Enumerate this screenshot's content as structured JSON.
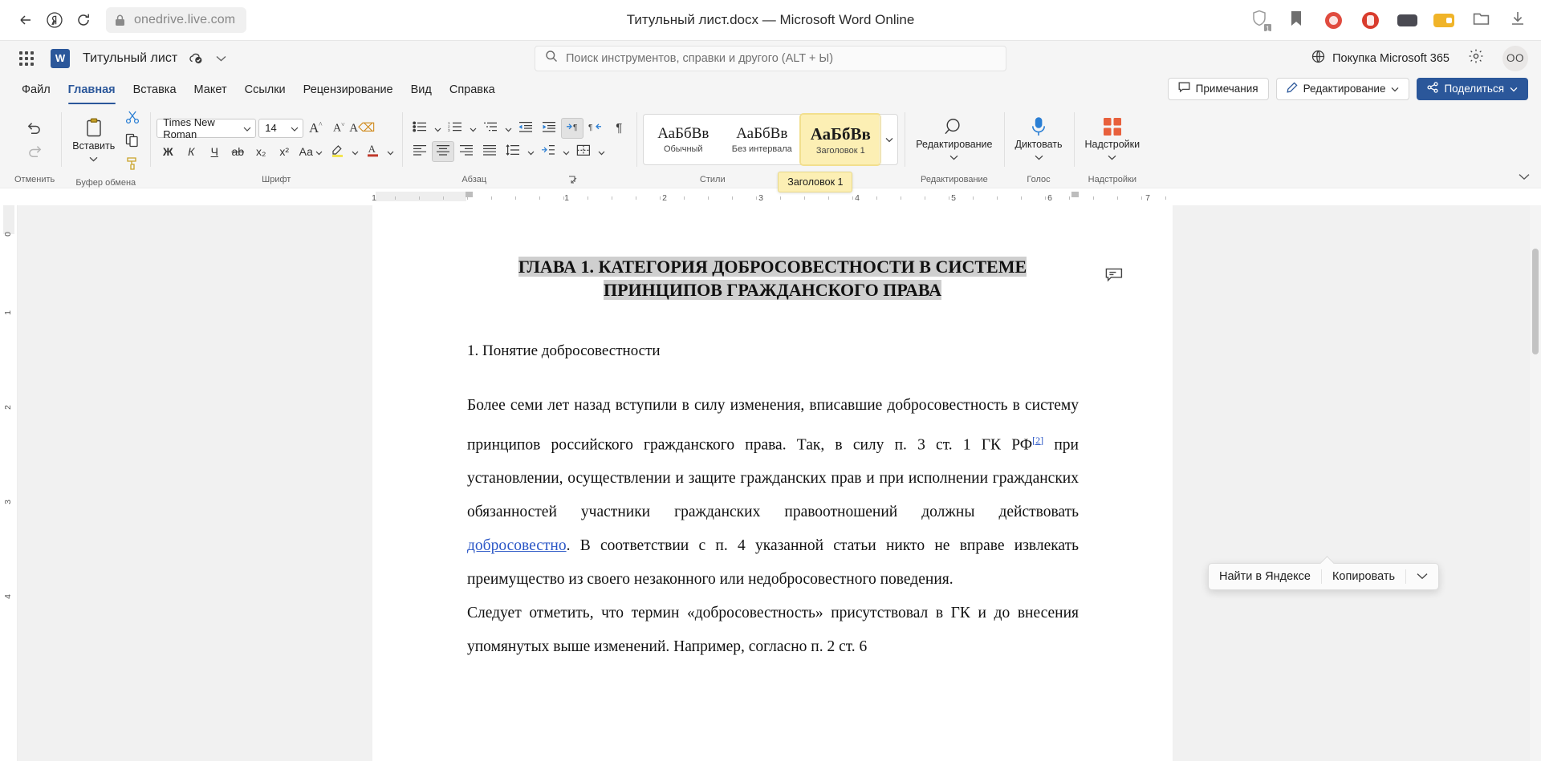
{
  "browser": {
    "back_icon": "arrow-left-icon",
    "yandex_icon": "yandex-logo-icon",
    "reload_icon": "reload-icon",
    "lock_icon": "lock-icon",
    "url": "onedrive.live.com",
    "page_title": "Титульный лист.docx — Microsoft Word Online",
    "right_icons": [
      {
        "name": "shield-icon",
        "badge": "1"
      },
      {
        "name": "bookmark-icon",
        "badge": ""
      },
      {
        "name": "extension-red-icon",
        "badge": ""
      },
      {
        "name": "extension-red2-icon",
        "badge": ""
      },
      {
        "name": "extension-dark-icon",
        "badge": ""
      },
      {
        "name": "extension-yellow-icon",
        "badge": ""
      },
      {
        "name": "collections-icon",
        "badge": ""
      },
      {
        "name": "downloads-icon",
        "badge": ""
      }
    ]
  },
  "app_header": {
    "waffle_icon": "app-launcher-icon",
    "word_logo": "W",
    "doc_name": "Титульный лист",
    "saved_icon": "saved-cloud-icon",
    "chevron_icon": "chevron-down-icon",
    "search": {
      "icon": "search-icon",
      "placeholder": "Поиск инструментов, справки и другого (ALT + Ы)",
      "value": ""
    },
    "buy_365": "Покупка Microsoft 365",
    "globe_icon": "globe-icon",
    "settings_icon": "gear-icon",
    "avatar_initials": "ОО"
  },
  "tabs": [
    {
      "label": "Файл",
      "active": false
    },
    {
      "label": "Главная",
      "active": true
    },
    {
      "label": "Вставка",
      "active": false
    },
    {
      "label": "Макет",
      "active": false
    },
    {
      "label": "Ссылки",
      "active": false
    },
    {
      "label": "Рецензирование",
      "active": false
    },
    {
      "label": "Вид",
      "active": false
    },
    {
      "label": "Справка",
      "active": false
    }
  ],
  "tabs_right": {
    "comments_label": "Примечания",
    "comments_icon": "comment-icon",
    "editing_label": "Редактирование",
    "editing_icon": "pencil-icon",
    "editing_chevron": "chevron-down-icon",
    "share_label": "Поделиться",
    "share_icon": "share-icon",
    "share_chevron": "chevron-down-icon"
  },
  "ribbon": {
    "groups": [
      {
        "label": "Отменить",
        "name": "undo-group"
      },
      {
        "label": "Буфер обмена",
        "name": "clipboard-group"
      },
      {
        "label": "Шрифт",
        "name": "font-group"
      },
      {
        "label": "Абзац",
        "name": "paragraph-group"
      },
      {
        "label": "Стили",
        "name": "styles-group"
      },
      {
        "label": "Редактирование",
        "name": "editing-group"
      },
      {
        "label": "Голос",
        "name": "voice-group"
      },
      {
        "label": "Надстройки",
        "name": "addins-group"
      }
    ],
    "undo": {
      "undo_icon": "undo-icon",
      "redo_icon": "redo-icon"
    },
    "clipboard": {
      "paste_label": "Вставить",
      "paste_icon": "paste-icon",
      "paste_chevron": "chevron-down-icon",
      "cut_icon": "scissors-icon",
      "copy_icon": "copy-icon",
      "format_painter_icon": "format-painter-icon"
    },
    "font": {
      "family": "Times New Roman",
      "size": "14",
      "grow_icon": "increase-font-size-icon",
      "shrink_icon": "decrease-font-size-icon",
      "clear_format_icon": "clear-formatting-icon",
      "bold": "Ж",
      "italic": "К",
      "underline": "Ч",
      "strike": "аb",
      "subscript": "x₂",
      "superscript": "x²",
      "case_label": "Аа",
      "highlight_icon": "highlight-color-icon",
      "font_color_icon": "font-color-icon"
    },
    "paragraph": {
      "bullets_icon": "bulleted-list-icon",
      "numbering_icon": "numbered-list-icon",
      "multilevel_icon": "multilevel-list-icon",
      "decrease_indent_icon": "decrease-indent-icon",
      "increase_indent_icon": "increase-indent-icon",
      "ltr_icon": "left-to-right-icon",
      "rtl_icon": "right-to-left-icon",
      "marks_icon": "formatting-marks-icon",
      "align_left_icon": "align-left-icon",
      "align_center_icon": "align-center-icon",
      "align_right_icon": "align-right-icon",
      "justify_icon": "justify-icon",
      "line_spacing_icon": "line-spacing-icon",
      "shading_icon": "shading-icon",
      "borders_icon": "borders-icon",
      "dialog_launcher_icon": "dialog-launcher-icon"
    },
    "styles": {
      "items": [
        {
          "sample": "АаБбВв",
          "name": "Обычный",
          "selected": false
        },
        {
          "sample": "АаБбВв",
          "name": "Без интервала",
          "selected": false
        },
        {
          "sample": "АаБбВв",
          "name": "Заголовок 1",
          "selected": true
        }
      ],
      "more_icon": "chevron-down-icon",
      "tooltip": "Заголовок 1",
      "dialog_launcher_icon": "dialog-launcher-icon"
    },
    "editing": {
      "label": "Редактирование",
      "icon": "magnifier-icon",
      "chevron": "chevron-down-icon"
    },
    "voice": {
      "label": "Диктовать",
      "icon": "microphone-icon",
      "chevron": "chevron-down-icon"
    },
    "addins": {
      "label": "Надстройки",
      "icon": "addins-grid-icon",
      "chevron": "chevron-down-icon"
    },
    "collapse_icon": "chevron-down-icon"
  },
  "ruler": {
    "h_labels": [
      "1",
      "1",
      "2",
      "3",
      "4",
      "5",
      "6",
      "7"
    ],
    "v_labels": [
      "1",
      "2",
      "3",
      "4"
    ]
  },
  "document": {
    "heading_line1": "ГЛАВА 1. КАТЕГОРИЯ ДОБРОСОВЕСТНОСТИ В СИСТЕМЕ",
    "heading_line2": "ПРИНЦИПОВ ГРАЖДАНСКОГО ПРАВА",
    "subheading": "1. Понятие добросовестности",
    "para1_a": "Более семи лет назад вступили в силу изменения, вписавшие добросовестность в систему принципов российского гражданского права. Так, в силу п. 3 ст. 1 ГК РФ",
    "footnote_ref": "[2]",
    "para1_b": " при установлении, осуществлении и защите гражданских прав и при исполнении гражданских обязанностей участники гражданских правоотношений должны действовать ",
    "link_text": "добросовестно",
    "para1_c": ". В соответствии с п. 4 указанной статьи никто не вправе извлекать преимущество из своего незаконного или недобросовестного поведения.",
    "para2": "Следует отметить, что термин «добросовестность» присутствовал в ГК и до внесения упомянутых выше изменений. Например, согласно п. 2 ст. 6",
    "comment_icon": "comment-bubble-icon"
  },
  "context_menu": {
    "items": [
      {
        "label": "Найти в Яндексе",
        "name": "find-in-yandex-item"
      },
      {
        "label": "Копировать",
        "name": "copy-item"
      }
    ],
    "chevron_icon": "chevron-down-icon"
  },
  "colors": {
    "accent": "#2b579a",
    "style_highlight": "#fcefb4",
    "selection": "#cfcfcf",
    "link": "#2a56c6"
  }
}
